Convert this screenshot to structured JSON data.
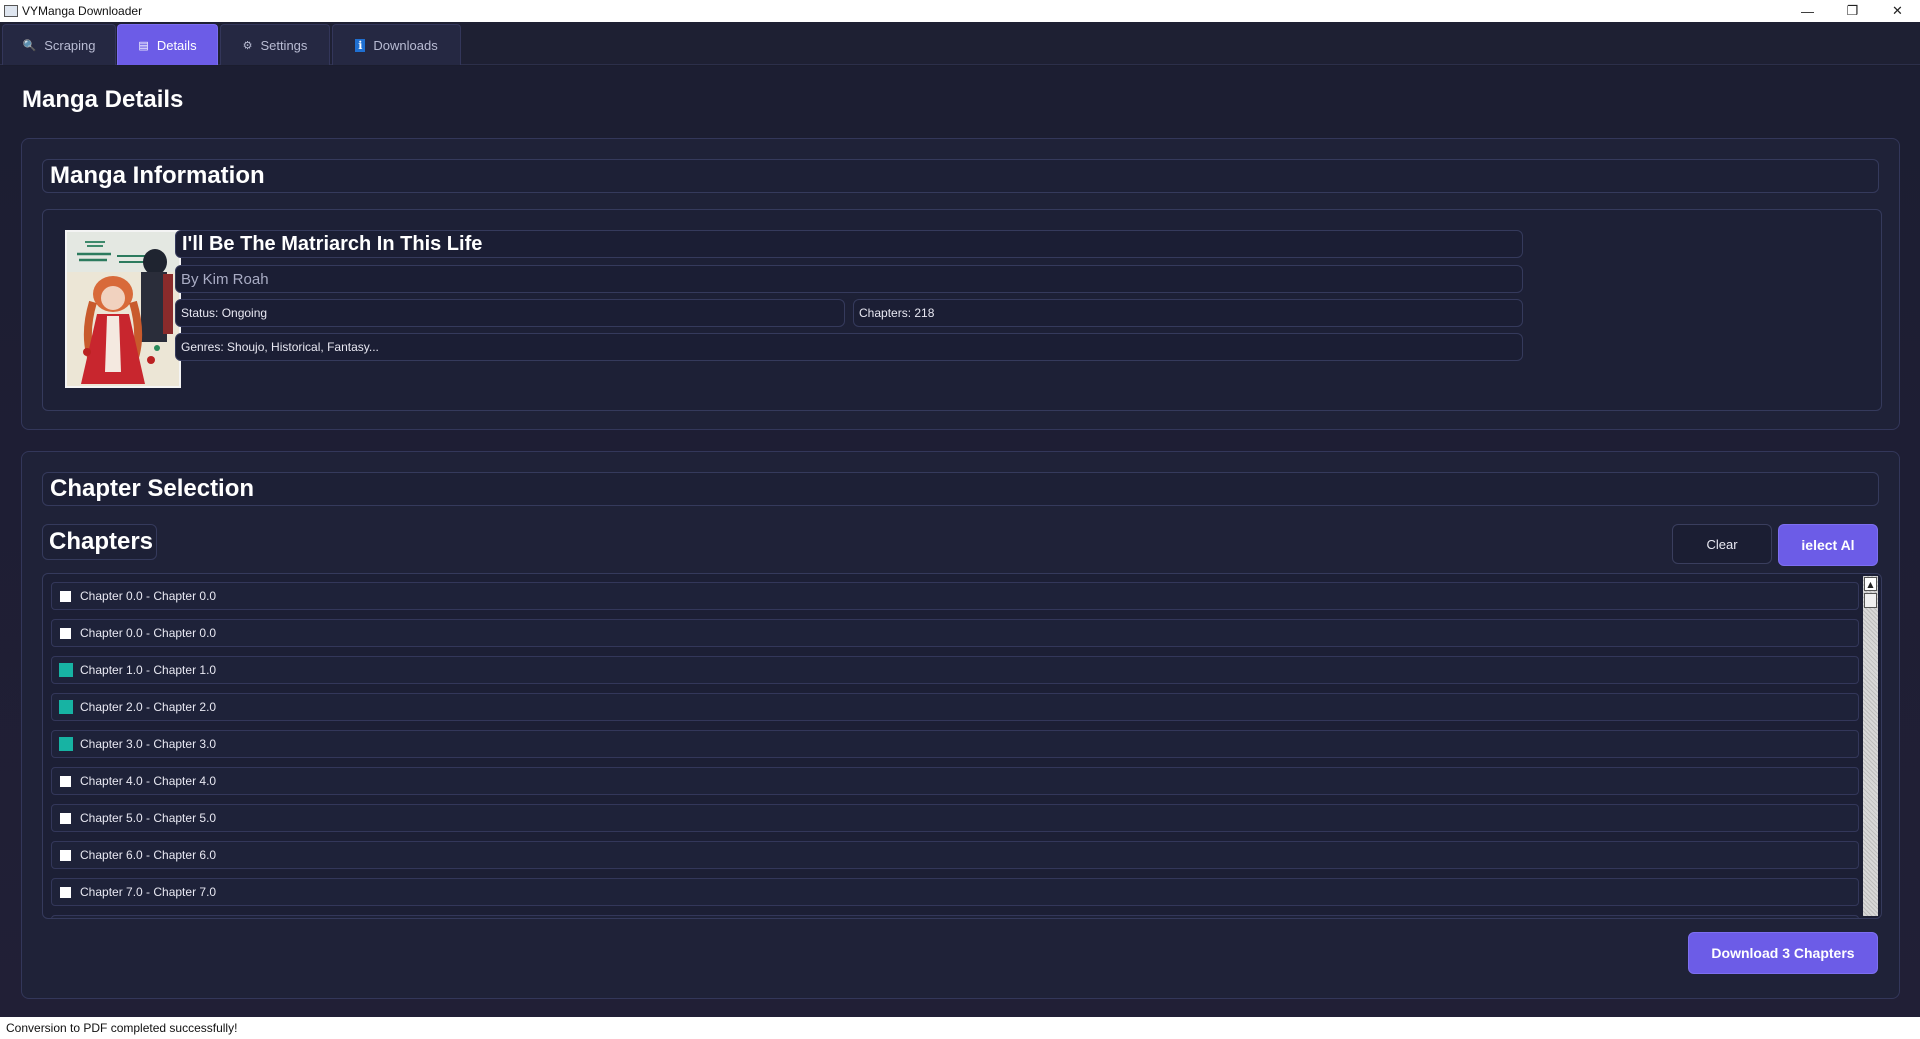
{
  "window": {
    "title": "VYManga Downloader",
    "minimize": "—",
    "restore": "❐",
    "close": "✕"
  },
  "tabs": [
    {
      "label": "Scraping",
      "icon": "search-icon",
      "glyph": "🔍",
      "active": false
    },
    {
      "label": "Details",
      "icon": "document-icon",
      "glyph": "▤",
      "active": true
    },
    {
      "label": "Settings",
      "icon": "gear-icon",
      "glyph": "⚙",
      "active": false
    },
    {
      "label": "Downloads",
      "icon": "info-icon",
      "glyph": "ℹ",
      "active": false
    }
  ],
  "page": {
    "title": "Manga Details"
  },
  "info": {
    "header": "Manga Information",
    "title": "I'll Be The Matriarch In This Life",
    "author": "By Kim Roah",
    "status": "Status: Ongoing",
    "chapters": "Chapters: 218",
    "genres": "Genres: Shoujo, Historical, Fantasy..."
  },
  "selection": {
    "header": "Chapter Selection",
    "chapters_label": "Chapters",
    "clear_label": "Clear",
    "select_all_label": "ielect Al",
    "download_label": "Download 3 Chapters"
  },
  "chapters": [
    {
      "label": "Chapter 0.0 - Chapter 0.0",
      "checked": false
    },
    {
      "label": "Chapter 0.0 - Chapter 0.0",
      "checked": false
    },
    {
      "label": "Chapter 1.0 - Chapter 1.0",
      "checked": true
    },
    {
      "label": "Chapter 2.0 - Chapter 2.0",
      "checked": true
    },
    {
      "label": "Chapter 3.0 - Chapter 3.0",
      "checked": true
    },
    {
      "label": "Chapter 4.0 - Chapter 4.0",
      "checked": false
    },
    {
      "label": "Chapter 5.0 - Chapter 5.0",
      "checked": false
    },
    {
      "label": "Chapter 6.0 - Chapter 6.0",
      "checked": false
    },
    {
      "label": "Chapter 7.0 - Chapter 7.0",
      "checked": false
    }
  ],
  "status_bar": {
    "text": "Conversion to PDF completed successfully!"
  },
  "colors": {
    "accent": "#6c5ce7",
    "checked": "#17b3a3",
    "background": "#1c1e32"
  }
}
